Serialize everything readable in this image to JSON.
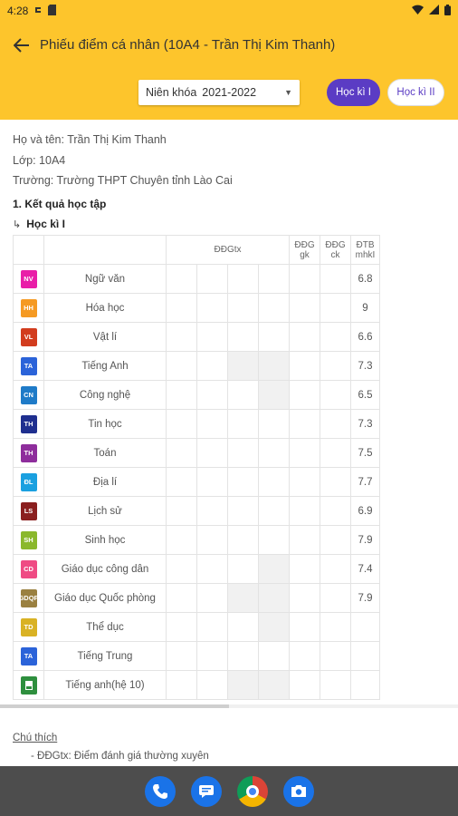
{
  "status_bar": {
    "time": "4:28"
  },
  "header": {
    "title": "Phiếu điểm cá nhân (10A4 - Trần Thị Kim Thanh)",
    "year_label": "Niên khóa",
    "year_value": "2021-2022",
    "term1_label": "Học kì I",
    "term2_label": "Học kì II"
  },
  "student": {
    "name_line": "Họ và tên: Trần Thị Kim Thanh",
    "class_line": "Lớp: 10A4",
    "school_line": "Trường: Trường THPT Chuyên tỉnh Lào Cai"
  },
  "section_title": "1. Kết quả học tập",
  "term_title": "Học kì I",
  "table_headers": {
    "ddgtx": "ĐĐGtx",
    "ddggk_1": "ĐĐG",
    "ddggk_2": "gk",
    "ddgck_1": "ĐĐG",
    "ddgck_2": "ck",
    "dtb_1": "ĐTB",
    "dtb_2": "mhkI"
  },
  "subjects": [
    {
      "code": "NV",
      "name": "Ngữ văn",
      "score": "6.8",
      "color": "#e91ea8"
    },
    {
      "code": "HH",
      "name": "Hóa học",
      "score": "9",
      "color": "#f59a23"
    },
    {
      "code": "VL",
      "name": "Vật lí",
      "score": "6.6",
      "color": "#d23c1e"
    },
    {
      "code": "TA",
      "name": "Tiếng Anh",
      "score": "7.3",
      "color": "#2b63d9"
    },
    {
      "code": "CN",
      "name": "Công nghệ",
      "score": "6.5",
      "color": "#1f7bc8"
    },
    {
      "code": "TH",
      "name": "Tin học",
      "score": "7.3",
      "color": "#1f2f8f"
    },
    {
      "code": "TH",
      "name": "Toán",
      "score": "7.5",
      "color": "#8e2d9c"
    },
    {
      "code": "ĐL",
      "name": "Địa lí",
      "score": "7.7",
      "color": "#1aa0e0"
    },
    {
      "code": "LS",
      "name": "Lịch sử",
      "score": "6.9",
      "color": "#8a1f1f"
    },
    {
      "code": "SH",
      "name": "Sinh học",
      "score": "7.9",
      "color": "#8ab82c"
    },
    {
      "code": "CD",
      "name": "Giáo dục công dân",
      "score": "7.4",
      "color": "#ef4b84"
    },
    {
      "code": "GDQP",
      "name": "Giáo dục Quốc phòng",
      "score": "7.9",
      "color": "#9a8040"
    },
    {
      "code": "TD",
      "name": "Thể dục",
      "score": "",
      "color": "#d9b224"
    },
    {
      "code": "TA",
      "name": "Tiếng Trung",
      "score": "",
      "color": "#2b63d9"
    },
    {
      "code": "",
      "name": "Tiếng anh(hệ 10)",
      "score": "",
      "color": "#2e8f3e"
    }
  ],
  "notes": {
    "title": "Chú thích",
    "item1": "- ĐĐGtx: Điểm đánh giá thường xuyên"
  },
  "dock": [
    "phone-app",
    "messages-app",
    "chrome-app",
    "camera-app"
  ]
}
